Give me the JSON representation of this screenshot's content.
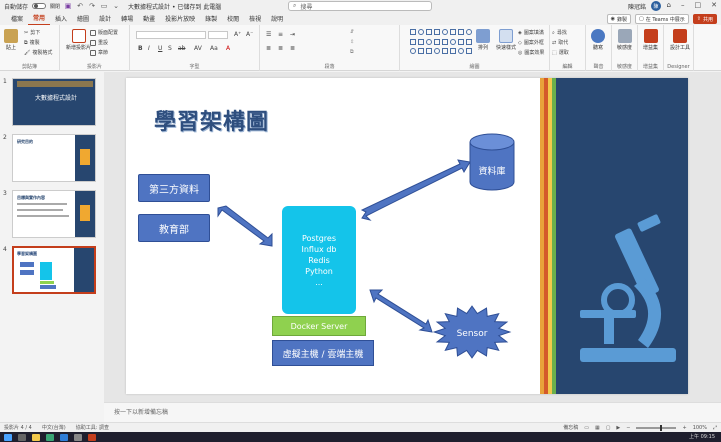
{
  "titlebar": {
    "autosave": "自動儲存",
    "autosave_state": "關閉",
    "doc_title": "大數據程式設計 • 已儲存到 此電腦",
    "search_placeholder": "搜尋",
    "user": "陳冠銘",
    "avatar": "陳"
  },
  "tabs": [
    "檔案",
    "常用",
    "插入",
    "繪圖",
    "設計",
    "轉場",
    "動畫",
    "投影片放映",
    "錄製",
    "校閱",
    "檢視",
    "說明"
  ],
  "tab_actions": {
    "record": "錄製",
    "teams": "在 Teams 中展示",
    "share": "共用"
  },
  "ribbon": {
    "groups": [
      "剪貼簿",
      "投影片",
      "字型",
      "段落",
      "繪圖",
      "編輯",
      "聲音",
      "敏感度",
      "增益集",
      "Designer"
    ],
    "paste": "貼上",
    "cut": "剪下",
    "copy": "複製",
    "format_painter": "複製格式",
    "new_slide": "新增投影片",
    "layout": "版面配置",
    "reset": "重設",
    "section": "章節",
    "font_name": "",
    "font_size": "",
    "arrange": "排列",
    "quick_styles": "快速樣式",
    "shape_fill": "圖案填滿",
    "shape_outline": "圖案外框",
    "shape_effects": "圖案效果",
    "find": "尋找",
    "replace": "取代",
    "select": "選取",
    "dictate": "聽寫",
    "sensitivity": "敏感度",
    "addins": "增益集",
    "designer": "設計工具"
  },
  "thumbs": [
    {
      "num": "1",
      "title": "大數據程式設計"
    },
    {
      "num": "2",
      "title": "研究目的"
    },
    {
      "num": "3",
      "title": "目標與實作內容"
    },
    {
      "num": "4",
      "title": "學習架構圖"
    }
  ],
  "slide": {
    "title": "學習架構圖",
    "third_party": "第三方資料",
    "education": "教育部",
    "database": "資料庫",
    "server_lines": [
      "Postgres",
      "Influx db",
      "Redis",
      "Python",
      "..."
    ],
    "docker": "Docker Server",
    "host": "虛擬主機 / 雲端主機",
    "sensor": "Sensor"
  },
  "notes_placeholder": "按一下以新增備忘稿",
  "status": {
    "slide_count": "投影片 4 / 4",
    "language": "中文(台灣)",
    "accessibility": "協助工具: 調查",
    "notes": "備忘稿",
    "zoom": "100%"
  },
  "clock": "上午 09:15",
  "colors": {
    "accent": "#c43e1c",
    "title_blue": "#2e4e7e",
    "box_blue": "#4f74c2",
    "server_cyan": "#14c4ea",
    "docker_green": "#8fd14f",
    "panel_navy": "#27466f",
    "micro_blue": "#5a9bd5"
  }
}
